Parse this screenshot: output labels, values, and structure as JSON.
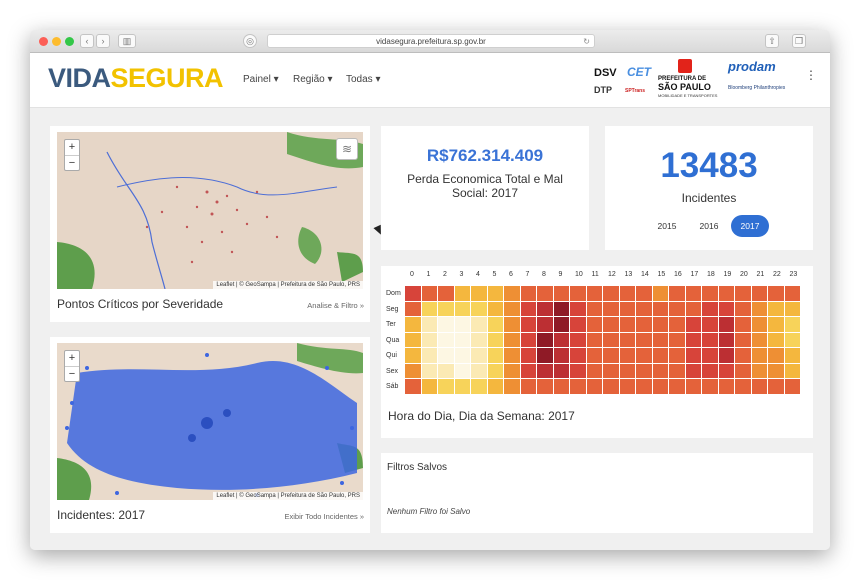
{
  "browser": {
    "url": "vidasegura.prefeitura.sp.gov.br"
  },
  "brand": {
    "logo_part1": "VIDA",
    "logo_part2": "SEGURA",
    "accent": "#3a73d6"
  },
  "menu": [
    {
      "label": "Painel ▾"
    },
    {
      "label": "Região ▾"
    },
    {
      "label": "Todas ▾"
    }
  ],
  "partners": {
    "dsv": "DSV",
    "cet": "CET",
    "dtp": "DTP",
    "sptrans": "SPTrans",
    "prefeitura_line1": "PREFEITURA DE",
    "prefeitura_line2": "SÃO PAULO",
    "prefeitura_line3": "MOBILIDADE E TRANSPORTES",
    "prodam": "prodam",
    "bloomberg": "Bloomberg Philanthropies"
  },
  "map_top": {
    "zoom_in": "+",
    "zoom_out": "−",
    "attribution": "Leaflet | © GeoSampa | Prefeitura de São Paulo, PRS",
    "title": "Pontos Críticos por Severidade",
    "link": "Analise & Filtro »"
  },
  "map_bottom": {
    "zoom_in": "+",
    "zoom_out": "−",
    "attribution": "Leaflet | © GeoSampa | Prefeitura de São Paulo, PRS",
    "title": "Incidentes: 2017",
    "link": "Exibir Todo Incidentes »"
  },
  "loss": {
    "value": "R$762.314.409",
    "label": "Perda Economica Total e Mal Social: 2017"
  },
  "incidents": {
    "count": "13483",
    "label": "Incidentes",
    "years": [
      "2015",
      "2016",
      "2017"
    ],
    "active_year": "2017"
  },
  "heatmap": {
    "title": "Hora do Dia, Dia da Semana: 2017",
    "hours": [
      "0",
      "1",
      "2",
      "3",
      "4",
      "5",
      "6",
      "7",
      "8",
      "9",
      "10",
      "11",
      "12",
      "13",
      "14",
      "15",
      "16",
      "17",
      "18",
      "19",
      "20",
      "21",
      "22",
      "23"
    ],
    "days": [
      "Dom",
      "Seg",
      "Ter",
      "Qua",
      "Qui",
      "Sex",
      "Sáb"
    ],
    "colors": [
      "#fdf7e3",
      "#fbeab4",
      "#f7d35a",
      "#f4b73e",
      "#ee8f34",
      "#e4623a",
      "#d7443a",
      "#bc2f33",
      "#8f1a26"
    ],
    "grid": [
      [
        6,
        5,
        5,
        3,
        3,
        3,
        4,
        5,
        5,
        5,
        5,
        5,
        5,
        5,
        5,
        4,
        5,
        5,
        5,
        5,
        5,
        5,
        5,
        5
      ],
      [
        5,
        2,
        2,
        2,
        2,
        3,
        4,
        6,
        7,
        8,
        6,
        5,
        5,
        5,
        5,
        5,
        5,
        5,
        6,
        6,
        5,
        4,
        3,
        3
      ],
      [
        3,
        1,
        0,
        0,
        1,
        2,
        4,
        6,
        7,
        8,
        6,
        5,
        5,
        5,
        5,
        5,
        5,
        6,
        6,
        7,
        5,
        4,
        3,
        2
      ],
      [
        3,
        1,
        0,
        0,
        1,
        2,
        4,
        6,
        8,
        7,
        6,
        5,
        5,
        5,
        5,
        5,
        5,
        6,
        6,
        7,
        5,
        4,
        3,
        2
      ],
      [
        3,
        1,
        0,
        0,
        1,
        2,
        4,
        6,
        8,
        7,
        6,
        5,
        5,
        5,
        5,
        5,
        5,
        6,
        6,
        7,
        5,
        4,
        4,
        3
      ],
      [
        4,
        1,
        1,
        0,
        1,
        2,
        4,
        6,
        7,
        7,
        6,
        5,
        5,
        5,
        5,
        5,
        5,
        6,
        6,
        6,
        5,
        4,
        4,
        3
      ],
      [
        5,
        3,
        2,
        2,
        2,
        3,
        4,
        5,
        5,
        5,
        5,
        5,
        5,
        5,
        5,
        5,
        5,
        5,
        5,
        5,
        5,
        5,
        5,
        5
      ]
    ]
  },
  "saved_filters": {
    "title": "Filtros Salvos",
    "empty": "Nenhum Filtro foi Salvo"
  }
}
